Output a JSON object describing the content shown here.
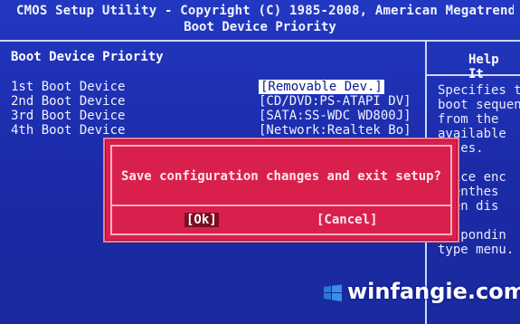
{
  "header": {
    "title": "CMOS Setup Utility - Copyright (C) 1985-2008, American Megatrends, I",
    "subtitle": "Boot Device Priority"
  },
  "left_panel": {
    "title": "Boot Device Priority",
    "items": [
      {
        "label": "1st Boot Device",
        "value": "[Removable Dev.]"
      },
      {
        "label": "2nd Boot Device",
        "value": "[CD/DVD:PS-ATAPI DV]"
      },
      {
        "label": "3rd Boot Device",
        "value": "[SATA:SS-WDC WD800J]"
      },
      {
        "label": "4th Boot Device",
        "value": "[Network:Realtek Bo]"
      }
    ]
  },
  "help_panel": {
    "title": "Help It",
    "text": "Specifies t\nboot sequen\nfrom the\navailable\nvices.\n\nevice enc\narenthes\nbeen dis\nhe\nrespondin\ntype menu."
  },
  "dialog": {
    "message": "Save configuration changes and exit setup?",
    "ok_label": "[Ok]",
    "cancel_label": "[Cancel]"
  },
  "watermark": {
    "text": "winfangie.com"
  },
  "colors": {
    "background": "#1d2fb3",
    "dialog": "#d9204d",
    "text": "#e6e8ff"
  }
}
